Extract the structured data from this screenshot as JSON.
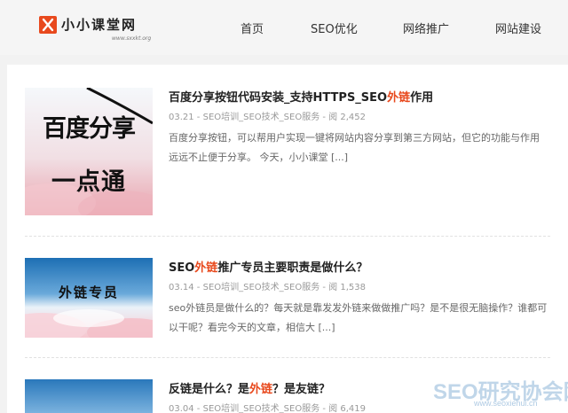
{
  "header": {
    "logo_text": "小小课堂网",
    "logo_sub": "www.sxxkt.org",
    "nav": [
      "首页",
      "SEO优化",
      "网络推广",
      "网站建设"
    ]
  },
  "posts": [
    {
      "title_pre": "百度分享按钮代码安装_支持HTTPS_SEO",
      "title_hl": "外链",
      "title_post": "作用",
      "meta": "03.21 - SEO培训_SEO技术_SEO服务 - 阅 2,452",
      "excerpt": "百度分享按钮，可以帮用户实现一键将网站内容分享到第三方网站，但它的功能与作用远远不止便于分享。 今天，小小课堂 [...]",
      "thumb_line1": "百度分享",
      "thumb_line2": "一点通"
    },
    {
      "title_pre": "SEO",
      "title_hl": "外链",
      "title_post": "推广专员主要职责是做什么？",
      "meta": "03.14 - SEO培训_SEO技术_SEO服务 - 阅 1,538",
      "excerpt": "seo外链员是做什么的？每天就是靠发发外链来做做推广吗？是不是很无脑操作？谁都可以干呢？看完今天的文章，相信大 [...]",
      "thumb_label": "外链专员"
    },
    {
      "title_pre": "反链是什么？是",
      "title_hl": "外链",
      "title_post": "？是友链？",
      "meta": "03.04 - SEO培训_SEO技术_SEO服务 - 阅 6,419"
    }
  ],
  "watermark": {
    "main": "SEO研究协会网",
    "sub": "www.seoxiehui.cn"
  },
  "colors": {
    "accent": "#e8491d",
    "background": "#f2f2f2",
    "panel": "#ffffff"
  }
}
